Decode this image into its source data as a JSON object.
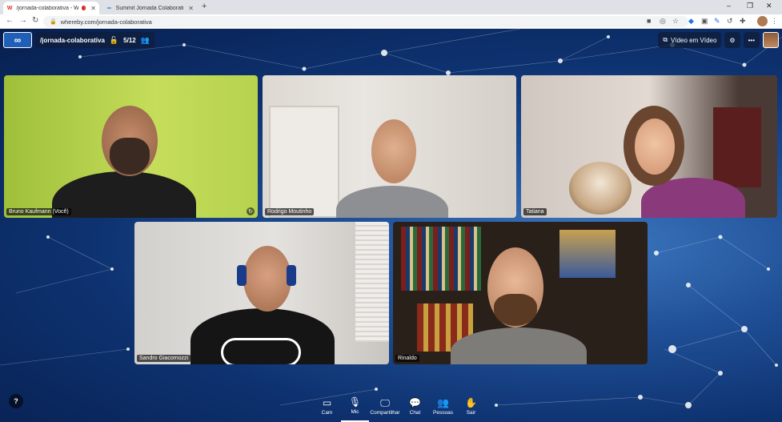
{
  "browser": {
    "tabs": [
      {
        "title": "/jornada-colaborativa - Whe",
        "favicon": "W",
        "active": true,
        "recording": true
      },
      {
        "title": "Summit Jornada Colaborativa | A",
        "favicon": "∞",
        "active": false,
        "recording": false
      }
    ],
    "new_tab": "+",
    "url": "whereby.com/jornada-colaborativa",
    "window_controls": {
      "minimize": "–",
      "maximize": "❐",
      "close": "✕"
    }
  },
  "room": {
    "name": "/jornada-colaborativa",
    "participants_count": "5/12",
    "video_in_video_label": "Vídeo em Vídeo"
  },
  "participants": [
    {
      "name": "Bruno Kaufmann (Você)"
    },
    {
      "name": "Rodrigo Moutinho"
    },
    {
      "name": "Tatiana"
    },
    {
      "name": "Sandro Giacomozzi"
    },
    {
      "name": "Rinaldo"
    }
  ],
  "controls": [
    {
      "label": "Cam",
      "icon": "camera-icon"
    },
    {
      "label": "Mic",
      "icon": "microphone-icon"
    },
    {
      "label": "Compartilhar",
      "icon": "screen-share-icon"
    },
    {
      "label": "Chat",
      "icon": "chat-icon"
    },
    {
      "label": "Pessoas",
      "icon": "people-icon"
    },
    {
      "label": "Sair",
      "icon": "leave-hand-icon"
    }
  ],
  "help_label": "?",
  "colors": {
    "stage_bg": "#1f4f96",
    "leave": "#ff6b4a",
    "recording": "#d93025"
  }
}
